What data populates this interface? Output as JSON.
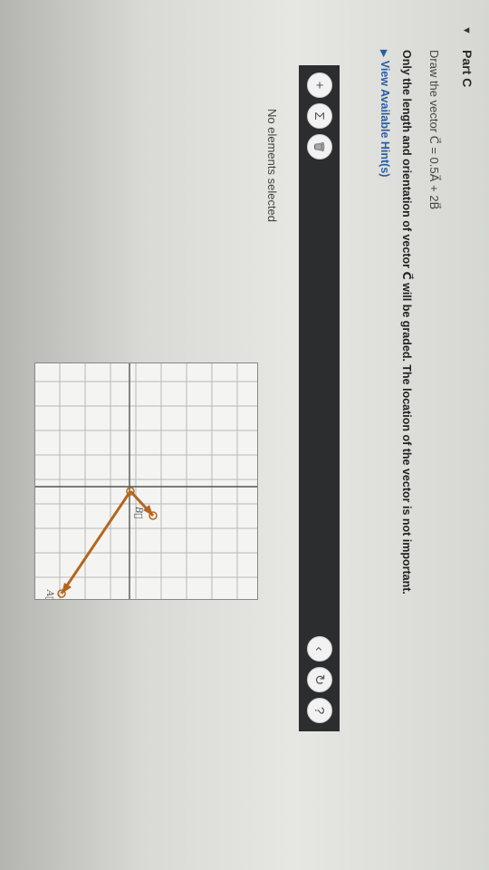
{
  "part": {
    "title": "Part C",
    "toggle_icon": "triangle-down-icon"
  },
  "instruction": {
    "text": "Draw the vector C⃗ = 0.5A⃗ + 2B⃗"
  },
  "grading_note": {
    "text": "Only the length and orientation of vector C⃗ will be graded. The location of the vector is not important."
  },
  "hints": {
    "label": "View Available Hint(s)"
  },
  "toolbar": {
    "add_icon": "plus-icon",
    "add_symbol": "+",
    "sum_icon": "sigma-icon",
    "sum_symbol": "Σ",
    "delete_icon": "trash-icon",
    "delete_symbol": "🗑",
    "collapse_icon": "chevron-icon",
    "collapse_symbol": "‹",
    "reset_icon": "reset-icon",
    "reset_symbol": "↻",
    "help_icon": "help-icon",
    "help_symbol": "?"
  },
  "selection_status": {
    "text": "No elements selected"
  },
  "graph": {
    "vectors": [
      {
        "label": "A⃗",
        "color": "#b5651d"
      },
      {
        "label": "B⃗",
        "color": "#b5651d"
      }
    ],
    "accent_color": "#b5651d"
  }
}
